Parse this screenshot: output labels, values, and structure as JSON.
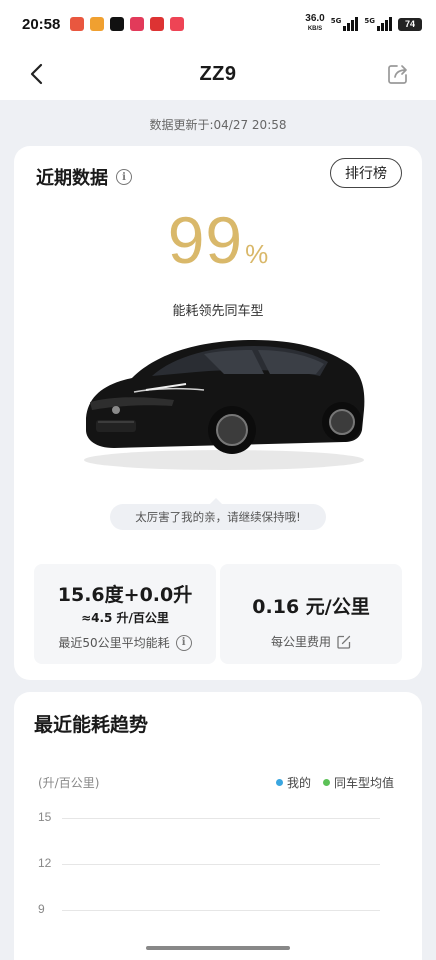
{
  "status_bar": {
    "time": "20:58",
    "net_speed": "36.0",
    "net_unit": "KB/S",
    "sig1_tag": "5G",
    "sig2_tag": "5G",
    "battery": "74"
  },
  "nav": {
    "title": "ZZ9"
  },
  "update": {
    "text": "数据更新于:04/27 20:58"
  },
  "recent": {
    "title": "近期数据",
    "rank_label": "排行榜",
    "percent": "99",
    "percent_sign": "%",
    "caption": "能耗领先同车型",
    "encourage": "太厉害了我的亲，请继续保持哦!",
    "stat_left": {
      "main": "15.6度+0.0升",
      "sub": "≈4.5 升/百公里",
      "label": "最近50公里平均能耗"
    },
    "stat_right": {
      "main": "0.16 元/公里",
      "label": "每公里费用"
    }
  },
  "trend": {
    "title": "最近能耗趋势",
    "unit": "(升/百公里)",
    "legend": [
      {
        "name": "我的",
        "color": "#3aa6e0"
      },
      {
        "name": "同车型均值",
        "color": "#5cc157"
      }
    ],
    "ticks": [
      "15",
      "12",
      "9"
    ]
  },
  "colors": {
    "accent_gold": "#d9b86a",
    "background": "#eef0f4"
  }
}
